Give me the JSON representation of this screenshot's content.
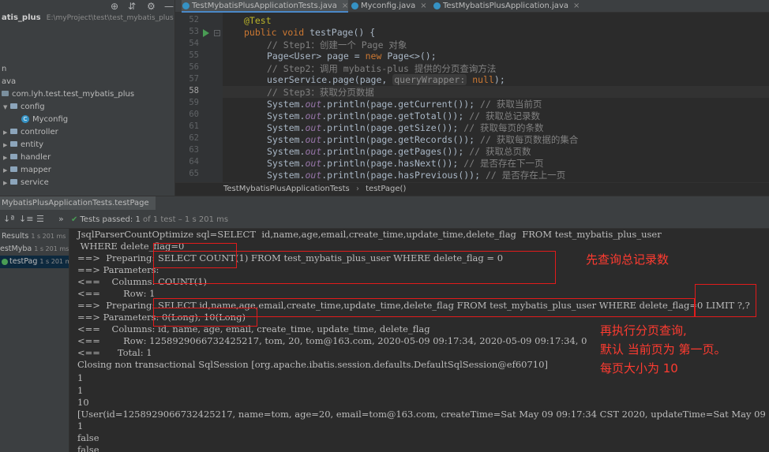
{
  "project_panel": {
    "root_name": "atis_plus",
    "root_path": "E:\\myProject\\test\\test_mybatis_plus",
    "fragments": [
      "n",
      "ava"
    ],
    "package": "com.lyh.test.test_mybatis_plus",
    "items": [
      {
        "label": "config",
        "kind": "folder",
        "expanded": true
      },
      {
        "label": "Myconfig",
        "kind": "class"
      },
      {
        "label": "controller",
        "kind": "folder"
      },
      {
        "label": "entity",
        "kind": "folder"
      },
      {
        "label": "handler",
        "kind": "folder"
      },
      {
        "label": "mapper",
        "kind": "folder"
      },
      {
        "label": "service",
        "kind": "folder"
      }
    ]
  },
  "editor_tabs": [
    {
      "label": "TestMybatisPlusApplicationTests.java",
      "active": true
    },
    {
      "label": "Myconfig.java",
      "active": false
    },
    {
      "label": "TestMybatisPlusApplication.java",
      "active": false
    }
  ],
  "code": {
    "line_numbers": [
      "52",
      "53",
      "54",
      "55",
      "56",
      "57",
      "58",
      "59",
      "60",
      "61",
      "62",
      "63",
      "64",
      "65"
    ],
    "lines": {
      "l52": "@Test",
      "l53_kw": "public void ",
      "l53_rest": "testPage() {",
      "l54": "// Step1：创建一个 Page 对象",
      "l55_a": "Page<User> page = ",
      "l55_kw": "new ",
      "l55_b": "Page<>();",
      "l56": "// Step2：调用 mybatis-plus 提供的分页查询方法",
      "l57_a": "userService.page(page, ",
      "l57_hint": "queryWrapper:",
      "l57_kw": " null",
      "l57_b": ");",
      "l58": "// Step3：获取分页数据",
      "l59_a": "System.",
      "l59_out": "out",
      "l59_b": ".println(page.getCurrent()); ",
      "l59_c": "// 获取当前页",
      "l60_b": ".println(page.getTotal()); ",
      "l60_c": "// 获取总记录数",
      "l61_b": ".println(page.getSize()); ",
      "l61_c": "// 获取每页的条数",
      "l62_b": ".println(page.getRecords()); ",
      "l62_c": "// 获取每页数据的集合",
      "l63_b": ".println(page.getPages()); ",
      "l63_c": "// 获取总页数",
      "l64_b": ".println(page.hasNext()); ",
      "l64_c": "// 是否存在下一页",
      "l65_b": ".println(page.hasPrevious()); ",
      "l65_c": "// 是否存在上一页"
    }
  },
  "breadcrumb": {
    "class": "TestMybatisPlusApplicationTests",
    "separator": "›",
    "method": "testPage()"
  },
  "run": {
    "title": "MybatisPlusApplicationTests.testPage",
    "status_label": "Tests passed:",
    "status_count": "1",
    "status_detail": "of 1 test – 1 s 201 ms",
    "results": [
      {
        "label": "Results",
        "time": "1 s 201 ms"
      },
      {
        "label": "estMyba",
        "time": "1 s 201 ms"
      },
      {
        "label": "testPag",
        "time": "1 s 201 ms",
        "selected": true
      }
    ]
  },
  "console": {
    "lines": [
      "JsqlParserCountOptimize sql=SELECT  id,name,age,email,create_time,update_time,delete_flag  FROM test_mybatis_plus_user",
      " WHERE delete_flag=0",
      "==>  Preparing: SELECT COUNT(1) FROM test_mybatis_plus_user WHERE delete_flag = 0",
      "==> Parameters: ",
      "<==    Columns: COUNT(1)",
      "<==        Row: 1",
      "==>  Preparing: SELECT id,name,age,email,create_time,update_time,delete_flag FROM test_mybatis_plus_user WHERE delete_flag=0 LIMIT ?,?",
      "==> Parameters: 0(Long), 10(Long)",
      "<==    Columns: id, name, age, email, create_time, update_time, delete_flag",
      "<==        Row: 1258929066732425217, tom, 20, tom@163.com, 2020-05-09 09:17:34, 2020-05-09 09:17:34, 0",
      "<==      Total: 1",
      "Closing non transactional SqlSession [org.apache.ibatis.session.defaults.DefaultSqlSession@ef60710]",
      "1",
      "1",
      "10",
      "[User(id=1258929066732425217, name=tom, age=20, email=tom@163.com, createTime=Sat May 09 09:17:34 CST 2020, updateTime=Sat May 09 09:17:34",
      "1",
      "false",
      "false"
    ]
  },
  "annotations": {
    "count_note": "先查询总记录数",
    "page_note_1": "再执行分页查询,",
    "page_note_2": "默认 当前页为 第一页。",
    "page_note_3": "每页大小为 10"
  },
  "colors": {
    "annotation_red": "#e21b1b",
    "accent_blue": "#4a88c7",
    "success_green": "#499c54"
  }
}
